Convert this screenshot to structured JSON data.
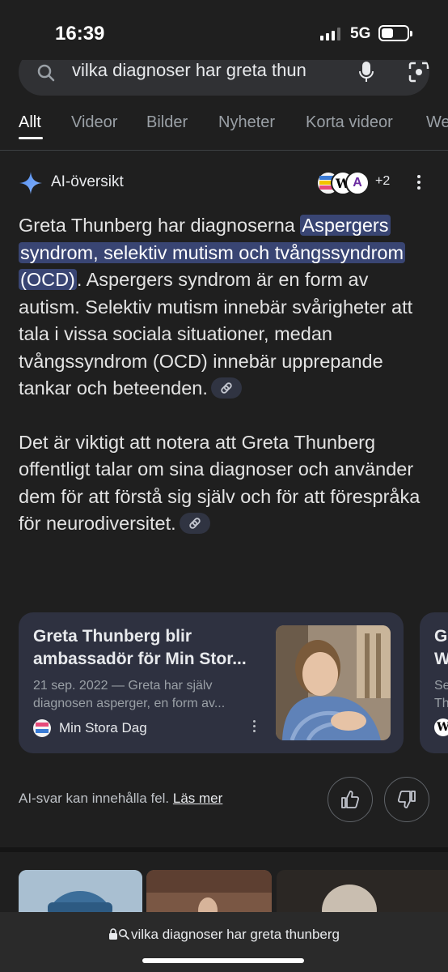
{
  "status_bar": {
    "time": "16:39",
    "network": "5G"
  },
  "search": {
    "query": "vilka diagnoser har greta thun"
  },
  "tabs": [
    {
      "label": "Allt",
      "active": true
    },
    {
      "label": "Videor"
    },
    {
      "label": "Bilder"
    },
    {
      "label": "Nyheter"
    },
    {
      "label": "Korta videor"
    },
    {
      "label": "We"
    }
  ],
  "ai_overview": {
    "title": "AI-översikt",
    "source_count": "+2",
    "favicon_2": "W",
    "favicon_3": "A",
    "para1_before": "Greta Thunberg har diagnoserna ",
    "para1_highlight": "Aspergers syndrom, selektiv mutism och tvångssyndrom (OCD)",
    "para1_after": ". Aspergers syndrom är en form av autism. Selektiv mutism innebär svårigheter att tala i vissa sociala situationer, medan tvångssyndrom (OCD) innebär upprepande tankar och beteenden.",
    "para2": "Det är viktigt att notera att Greta Thunberg offentligt talar om sina diagnoser och använder dem för att förstå sig själv och för att förespråka för neurodiversitet."
  },
  "cards": [
    {
      "title": "Greta Thunberg blir ambassadör för Min Stor...",
      "snippet": "21 sep. 2022 — Greta har själv diagnosen asperger, en form av...",
      "source": "Min Stora Dag"
    },
    {
      "title": "G\nW",
      "snippet": "Se\nTh",
      "favicon": "W"
    }
  ],
  "feedback": {
    "disclaimer": "AI-svar kan innehålla fel.",
    "learn_more": "Läs mer"
  },
  "bottom_bar": {
    "url": "vilka diagnoser har greta thunberg"
  },
  "colors": {
    "background": "#1f1f1f",
    "highlight": "#394573",
    "card": "#2e3140"
  }
}
